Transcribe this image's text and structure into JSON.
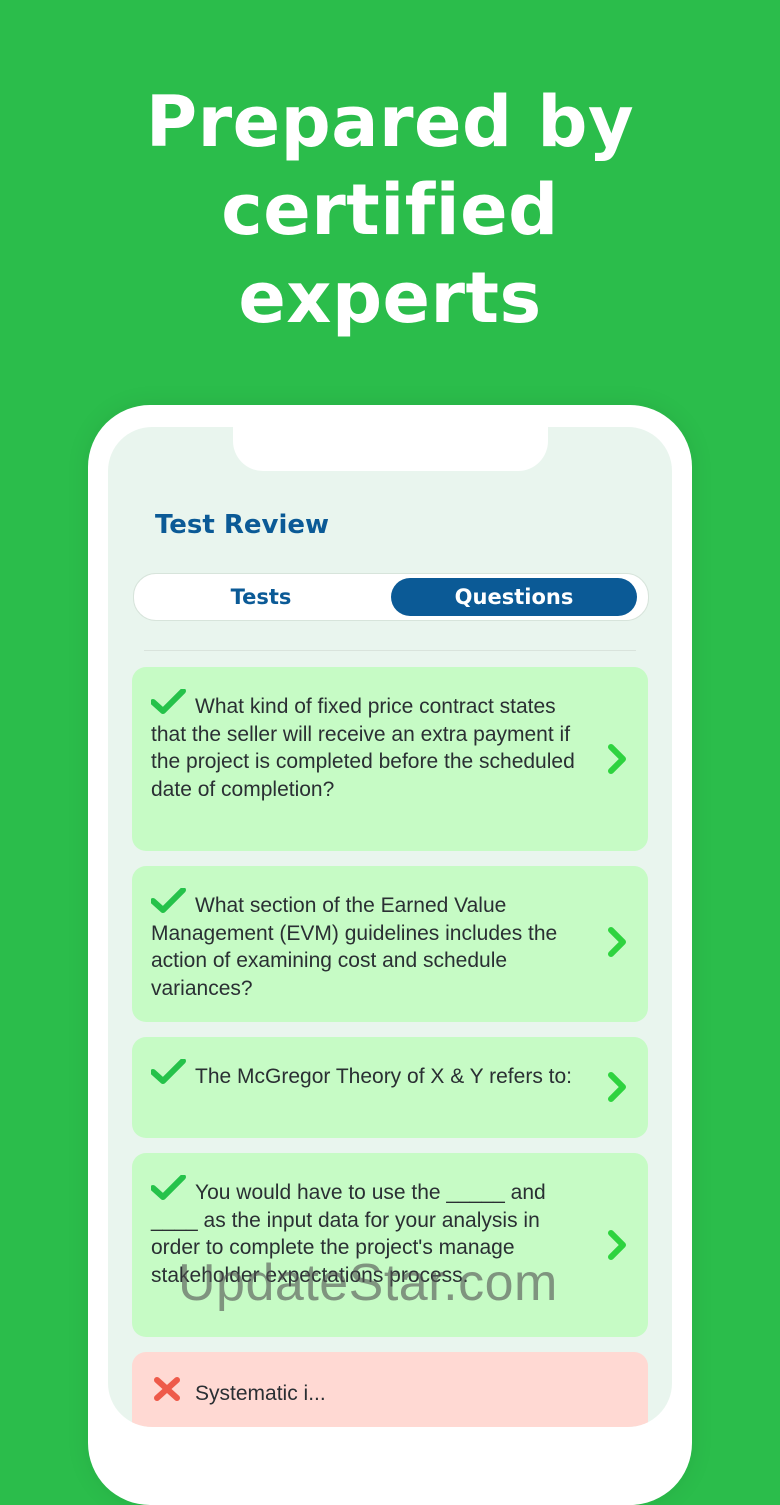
{
  "headline": {
    "line1": "Prepared by",
    "line2": "certified",
    "line3": "experts"
  },
  "screen": {
    "title": "Test Review",
    "tabs": {
      "tests": "Tests",
      "questions": "Questions",
      "selected": "Questions"
    },
    "questions": [
      {
        "status": "correct",
        "icon": "check-icon",
        "text": "What kind of fixed price contract states that the seller will receive an extra payment if the project is completed before the scheduled date of completion?"
      },
      {
        "status": "correct",
        "icon": "check-icon",
        "text": "What section of the Earned Value Management (EVM) guidelines includes the action of examining cost and schedule variances?"
      },
      {
        "status": "correct",
        "icon": "check-icon",
        "text": "The McGregor Theory of X & Y refers to:"
      },
      {
        "status": "correct",
        "icon": "check-icon",
        "text": "You would have to use the _____ and ____ as the input data for your analysis in order to complete the project's manage stakeholder expectations process."
      },
      {
        "status": "incorrect",
        "icon": "cross-icon",
        "text": "Systematic i..."
      }
    ]
  },
  "watermark": "UpdateStar.com",
  "colors": {
    "background": "#2bbd4b",
    "primary": "#0b5a96",
    "correct_card": "#c6fbc5",
    "incorrect_card": "#ffd9d3",
    "check": "#25c24a",
    "chevron": "#2ed33f",
    "cross": "#ee5a4a"
  }
}
